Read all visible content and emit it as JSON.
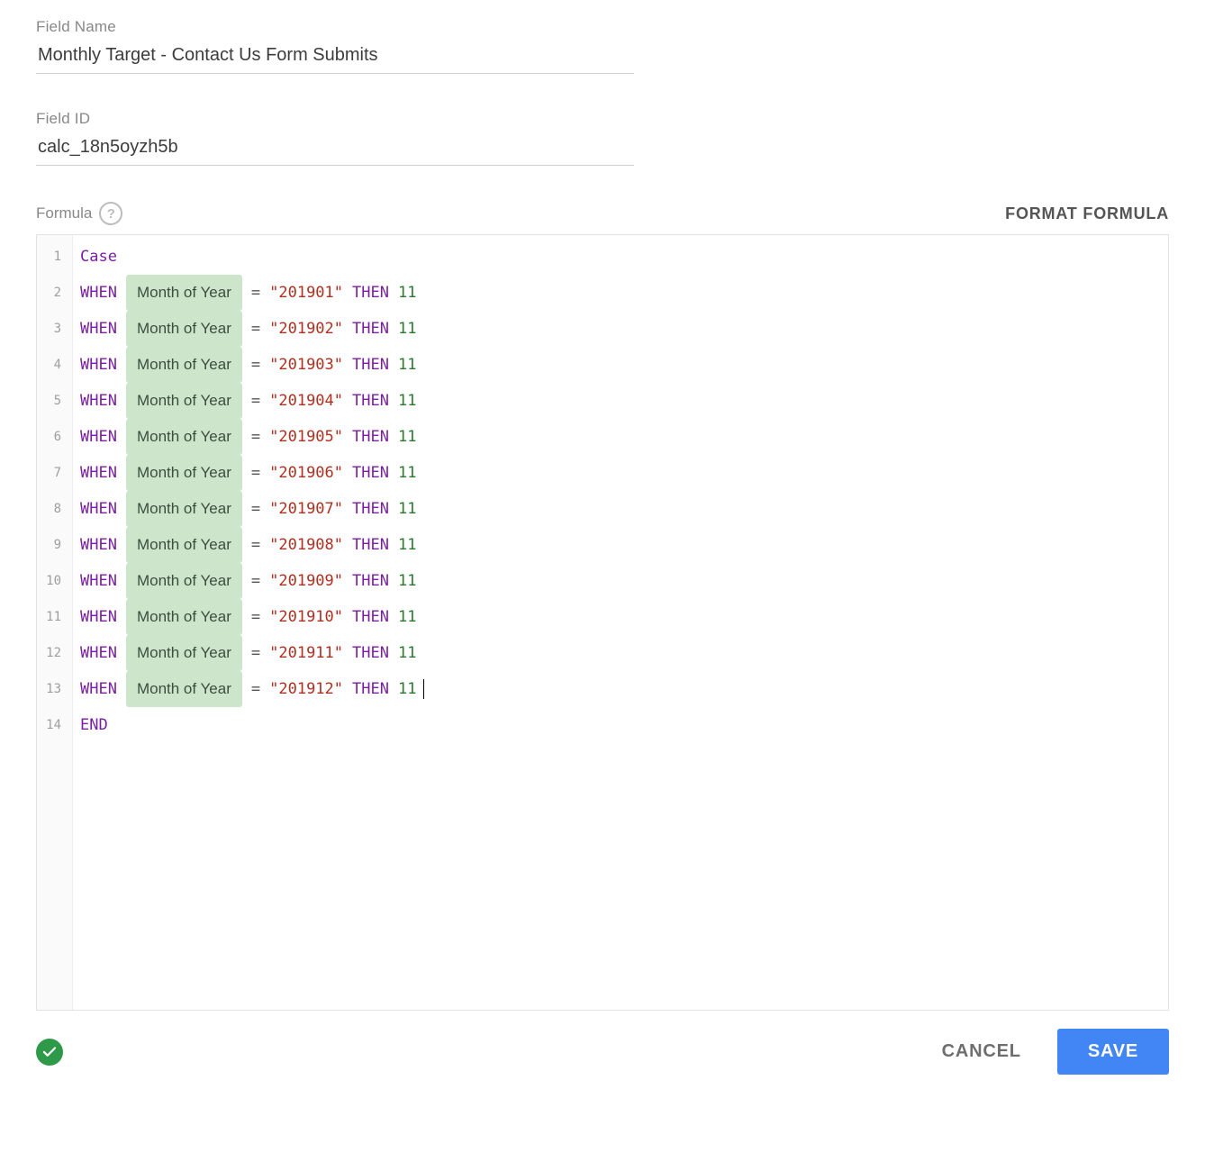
{
  "labels": {
    "field_name": "Field Name",
    "field_id": "Field ID",
    "formula": "Formula",
    "format_formula": "FORMAT FORMULA",
    "cancel": "CANCEL",
    "save": "SAVE"
  },
  "values": {
    "field_name": "Monthly Target - Contact Us Form Submits",
    "field_id": "calc_18n5oyzh5b"
  },
  "formula": {
    "start_keyword": "Case",
    "end_keyword": "END",
    "when_keyword": "WHEN",
    "then_keyword": "THEN",
    "eq": "=",
    "field_token": "Month of Year",
    "lines": [
      {
        "value": "201901",
        "result": "11"
      },
      {
        "value": "201902",
        "result": "11"
      },
      {
        "value": "201903",
        "result": "11"
      },
      {
        "value": "201904",
        "result": "11"
      },
      {
        "value": "201905",
        "result": "11"
      },
      {
        "value": "201906",
        "result": "11"
      },
      {
        "value": "201907",
        "result": "11"
      },
      {
        "value": "201908",
        "result": "11"
      },
      {
        "value": "201909",
        "result": "11"
      },
      {
        "value": "201910",
        "result": "11"
      },
      {
        "value": "201911",
        "result": "11"
      },
      {
        "value": "201912",
        "result": "11"
      }
    ],
    "total_lines": 14
  }
}
